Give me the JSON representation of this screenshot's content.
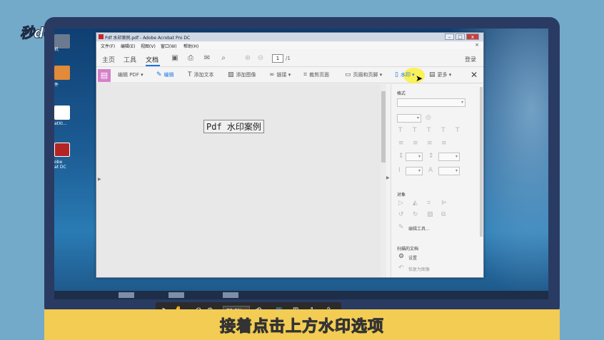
{
  "logo": {
    "text": "秒d◐ng视频"
  },
  "caption": {
    "text": "接着点击上方水印选项"
  },
  "desktop": {
    "icons": [
      {
        "name": "desktop-icon-1",
        "label": "机",
        "color": "#6c7a8f"
      },
      {
        "name": "desktop-icon-2",
        "label": "件",
        "color": "#e08a3a"
      },
      {
        "name": "desktop-icon-3",
        "label": "atXI...",
        "color": "#ffffff"
      },
      {
        "name": "desktop-icon-4",
        "label": "obe\nat DC",
        "color": "#b32525"
      }
    ]
  },
  "window": {
    "title": "Pdf 水印案例.pdf - Adobe Acrobat Pro DC",
    "menus": [
      "文件(F)",
      "编辑(E)",
      "视图(V)",
      "窗口(W)",
      "帮助(H)"
    ],
    "menu_close": "×",
    "nav": {
      "tabs": [
        "主页",
        "工具",
        "文档"
      ],
      "page_current": "1",
      "page_total": "/1",
      "login": "登录"
    },
    "toolbar": {
      "edit_pdf": "编辑 PDF ▾",
      "edit": "编辑",
      "add_text": "添加文本",
      "add_image": "添加图像",
      "link": "链接 ▾",
      "crop": "裁剪页面",
      "header_footer": "页眉和页脚 ▾",
      "watermark": "水印 ▾",
      "more": "更多 ▾",
      "close": "✕"
    },
    "document": {
      "text": "Pdf 水印案例"
    },
    "floating": {
      "zoom": "79.6% ▾"
    },
    "panel": {
      "format_head": "格式",
      "objects_head": "对象",
      "edit_tools": "编辑工具...",
      "scanned_head": "扫描的文档",
      "settings": "设置",
      "restore": "恢复为图像"
    }
  }
}
